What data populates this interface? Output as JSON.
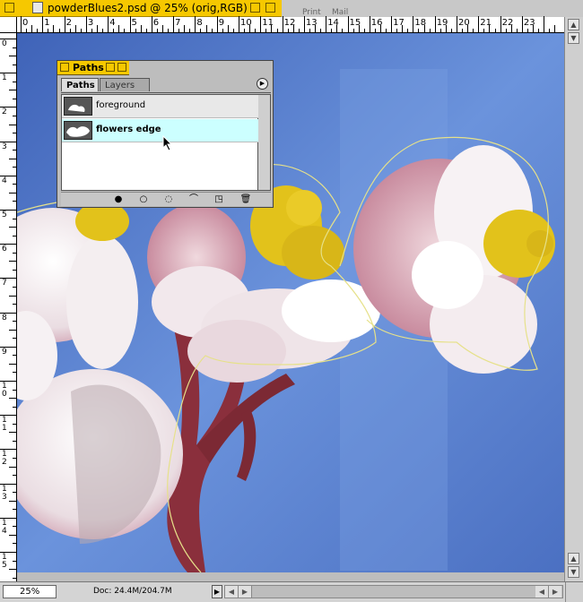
{
  "window": {
    "title": "powderBlues2.psd @ 25% (orig,RGB)",
    "background_items": [
      "Print",
      "Mail"
    ]
  },
  "rulers": {
    "top": [
      "0",
      "1",
      "2",
      "3",
      "4",
      "5",
      "6",
      "7",
      "8",
      "9",
      "10",
      "11",
      "12",
      "13",
      "14",
      "15",
      "16",
      "17",
      "18",
      "19",
      "20",
      "21",
      "22",
      "23"
    ],
    "left": [
      "0",
      "1",
      "2",
      "3",
      "4",
      "5",
      "6",
      "7",
      "8",
      "9",
      "10",
      "11",
      "12",
      "13",
      "14",
      "15"
    ]
  },
  "status": {
    "zoom": "25%",
    "doc": "Doc: 24.4M/204.7M"
  },
  "paths_palette": {
    "title": "Paths",
    "tabs": [
      {
        "label": "Paths",
        "active": true
      },
      {
        "label": "Layers",
        "active": false
      }
    ],
    "paths": [
      {
        "name": "foreground",
        "selected": false
      },
      {
        "name": "flowers edge",
        "selected": true
      }
    ],
    "tools": [
      {
        "icon": "fill-path-icon",
        "glyph": "●"
      },
      {
        "icon": "stroke-path-icon",
        "glyph": "○"
      },
      {
        "icon": "load-selection-icon",
        "glyph": "◌"
      },
      {
        "icon": "make-workpath-icon",
        "glyph": "⌒"
      },
      {
        "icon": "new-path-icon",
        "glyph": "◳"
      },
      {
        "icon": "trash-icon",
        "glyph": "🗑"
      }
    ]
  },
  "colors": {
    "title_active": "#f6c800",
    "selected_row": "#ccffff",
    "sky": "#5f86d3",
    "petal": "#f1e6ea",
    "center": "#e2c21b",
    "stem": "#8a2f3c"
  }
}
